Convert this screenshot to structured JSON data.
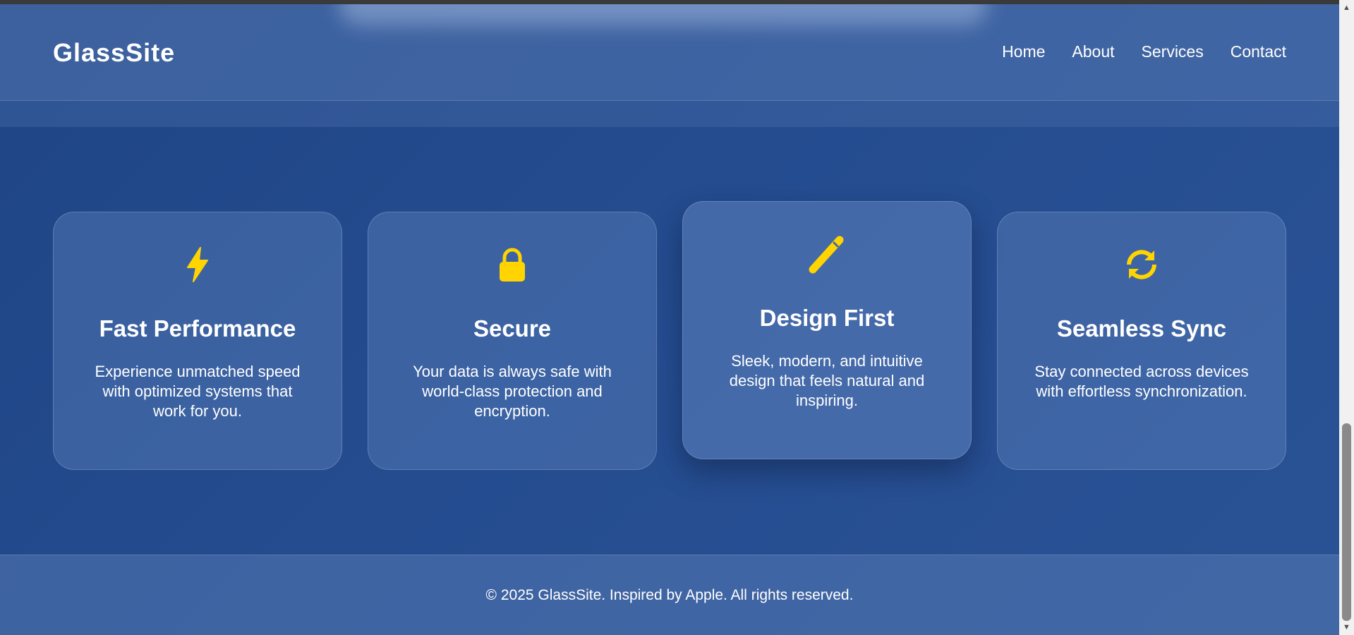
{
  "header": {
    "logo": "GlassSite",
    "nav": [
      {
        "label": "Home"
      },
      {
        "label": "About"
      },
      {
        "label": "Services"
      },
      {
        "label": "Contact"
      }
    ]
  },
  "features": [
    {
      "icon": "lightning-icon",
      "title": "Fast Performance",
      "description": "Experience unmatched speed with optimized systems that work for you."
    },
    {
      "icon": "lock-icon",
      "title": "Secure",
      "description": "Your data is always safe with world-class protection and encryption."
    },
    {
      "icon": "pencil-icon",
      "title": "Design First",
      "description": "Sleek, modern, and intuitive design that feels natural and inspiring."
    },
    {
      "icon": "sync-icon",
      "title": "Seamless Sync",
      "description": "Stay connected across devices with effortless synchronization."
    }
  ],
  "footer": {
    "text": "© 2025 GlassSite. Inspired by Apple. All rights reserved."
  },
  "colors": {
    "accent_icon": "#FFD400",
    "background": "#244c8f"
  }
}
